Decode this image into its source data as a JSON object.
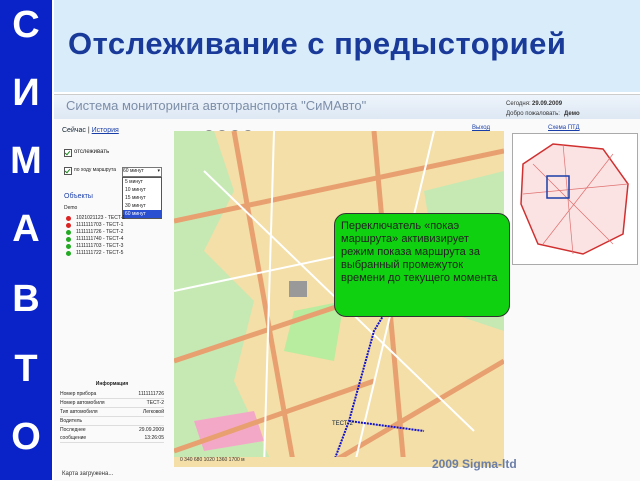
{
  "side_letters": [
    "С",
    "И",
    "М",
    "А",
    "В",
    "Т",
    "О"
  ],
  "slide_title": "Отслеживание с предысторией",
  "app": {
    "title": "Система мониторинга автотранспорта \"СиМАвто\"",
    "today_label": "Сегодня:",
    "today_value": "29.09.2009",
    "welcome_label": "Добро пожаловать:",
    "welcome_value": "Демо",
    "exit_label": "Выход",
    "mapnav_label": "Схема ПТД",
    "tab_now": "Сейчас",
    "tab_sep": "|",
    "tab_history": "История",
    "track_label": "отслеживать",
    "route_label": "по ходу маршрута",
    "route_select": "60 минут",
    "route_options": [
      "5 минут",
      "10 минут",
      "15 минут",
      "30 минут",
      "60 минут"
    ],
    "objects_label": "Объекты",
    "group_label": "Demo",
    "vehicles": [
      {
        "id": "1021021123 - ТЕСТ-1",
        "color": "#d22"
      },
      {
        "id": "1111111703 - ТЕСТ-1",
        "color": "#d22"
      },
      {
        "id": "1111111726 - ТЕСТ-2",
        "color": "#2a2"
      },
      {
        "id": "1111111740 - ТЕСТ-4",
        "color": "#2a2"
      },
      {
        "id": "1111111703 - ТЕСТ-3",
        "color": "#2a2"
      },
      {
        "id": "1111111722 - ТЕСТ-5",
        "color": "#2a2"
      }
    ],
    "info_title": "Информация",
    "info_rows": [
      {
        "k": "Номер прибора",
        "v": "1111111726"
      },
      {
        "k": "Номер автомобиля",
        "v": "ТЕСТ-2"
      },
      {
        "k": "Тип автомобиля",
        "v": "Легковой"
      },
      {
        "k": "Водитель",
        "v": ""
      },
      {
        "k": "Последнее",
        "v": "29.09.2009"
      },
      {
        "k": "сообщение",
        "v": "13:26:05"
      }
    ],
    "status_text": "Карта загружена...",
    "callout_text": "Переключатель «покаэ маршрута» активизирует режим показа маршрута за выбранный промежуток времени до текущего момента",
    "vehicle_tag": "ТЕСТ-2",
    "scale_text": "0   340   680   1020   1360   1700 м",
    "watermark": "2009 Sigma-ltd"
  },
  "colors": {
    "side_bg": "#0a23c8",
    "title_bg": "#d9ecfa",
    "title_text": "#1a3a9a",
    "callout_bg": "#0fd10f",
    "route": "#1010d0",
    "map_bg": "#f3dfa7"
  }
}
